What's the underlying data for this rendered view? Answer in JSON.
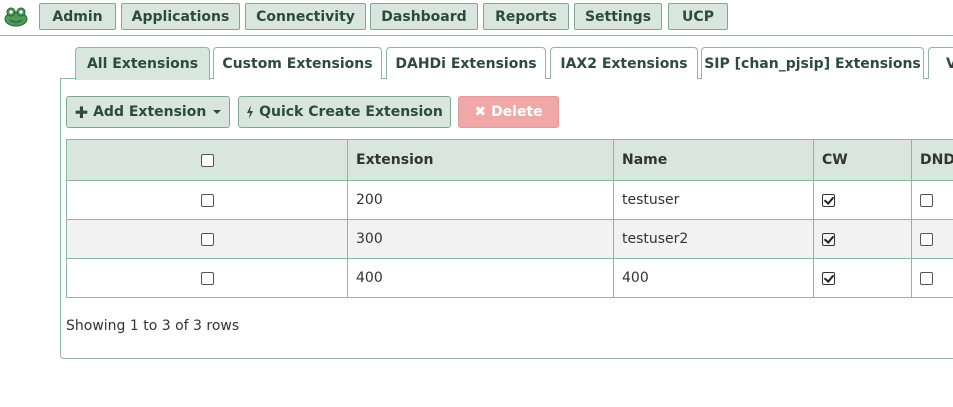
{
  "topnav": {
    "items": [
      "Admin",
      "Applications",
      "Connectivity",
      "Dashboard",
      "Reports",
      "Settings",
      "UCP"
    ]
  },
  "tabs": {
    "items": [
      "All Extensions",
      "Custom Extensions",
      "DAHDi Extensions",
      "IAX2 Extensions",
      "SIP [chan_pjsip] Extensions",
      "V"
    ],
    "active": "All Extensions"
  },
  "toolbar": {
    "add_label": "Add Extension",
    "quick_label": "Quick Create Extension",
    "delete_label": "Delete"
  },
  "table": {
    "headers": [
      "Extension",
      "Name",
      "CW",
      "DND"
    ],
    "rows": [
      {
        "extension": "200",
        "name": "testuser",
        "cw": true,
        "dnd": false
      },
      {
        "extension": "300",
        "name": "testuser2",
        "cw": true,
        "dnd": false
      },
      {
        "extension": "400",
        "name": "400",
        "cw": true,
        "dnd": false
      }
    ]
  },
  "footer": {
    "pagination_text": "Showing 1 to 3 of 3 rows"
  },
  "colors": {
    "accent": "#d9e6de",
    "border": "#8fb5a4",
    "danger": "#efa7a7",
    "text_dark": "#2c4a3d"
  }
}
